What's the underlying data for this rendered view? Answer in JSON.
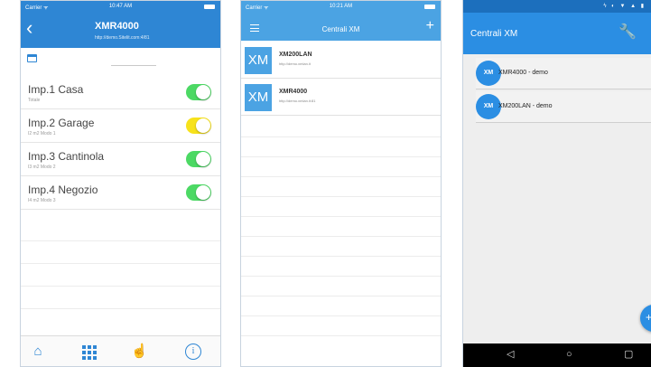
{
  "phone1": {
    "status": {
      "carrier": "Carrier ᯤ",
      "time": "10:47 AM"
    },
    "header": {
      "title": "XMR4000",
      "subtitle": "http://demo.Sitelit.com:4/81",
      "back_glyph": "‹"
    },
    "icons": {
      "back": "chevron-left-icon",
      "panel": "panel-icon",
      "home": "home-icon",
      "grid": "grid-icon",
      "hand": "hand-pointer-icon",
      "info": "info-icon"
    },
    "rows": [
      {
        "name": "Imp.1 Casa",
        "desc": "Totale",
        "toggle_color": "#4cd964",
        "on": true
      },
      {
        "name": "Imp.2 Garage",
        "desc": "I2 m2 Modo 1",
        "toggle_color": "#f7e21b",
        "on": true
      },
      {
        "name": "Imp.3 Cantinola",
        "desc": "I3 m2 Modo 2",
        "toggle_color": "#4cd964",
        "on": true
      },
      {
        "name": "Imp.4 Negozio",
        "desc": "I4 m2 Modo 3",
        "toggle_color": "#4cd964",
        "on": true
      }
    ],
    "tab_glyphs": {
      "home": "⌂",
      "hand": "☝",
      "info": "i"
    },
    "accent": "#2e86d4"
  },
  "phone2": {
    "status": {
      "carrier": "Carrier ᯤ",
      "time": "10:21 AM"
    },
    "header": {
      "title": "Centrali XM",
      "plus_glyph": "+"
    },
    "icons": {
      "menu": "hamburger-menu-icon",
      "add": "plus-icon"
    },
    "items": [
      {
        "logo": "XM",
        "name": "XM200LAN",
        "sub": "http://demo.xmlan.it"
      },
      {
        "logo": "XM",
        "name": "XMR4000",
        "sub": "http://demo.xmlan.it:81"
      }
    ],
    "accent": "#4ba3e3"
  },
  "phone3": {
    "status": {
      "icons": "ϟ ◐ ▼ ▲ ▮"
    },
    "header": {
      "title": "Centrali XM",
      "wrench_glyph": "🔧"
    },
    "icons": {
      "settings": "wrench-icon",
      "add": "plus-fab-icon",
      "back": "triangle-back-icon",
      "home": "circle-home-icon",
      "recents": "square-recents-icon"
    },
    "cards": [
      {
        "badge": "XM",
        "label": "XMR4000 - demo"
      },
      {
        "badge": "XM",
        "label": "XM200LAN - demo"
      }
    ],
    "fab_glyph": "+",
    "nav_glyphs": {
      "back": "◁",
      "home": "○",
      "recents": "▢"
    },
    "accent": "#2b8ee3"
  }
}
